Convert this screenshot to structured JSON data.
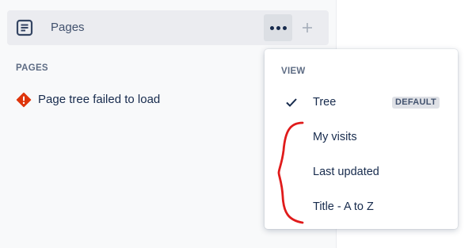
{
  "sidebar": {
    "pages_row": {
      "label": "Pages",
      "icon": "document-icon",
      "more_icon": "more-icon",
      "add_icon": "plus-icon"
    },
    "section_heading": "PAGES",
    "error": {
      "icon": "warning-icon",
      "text": "Page tree failed to load",
      "color": "#de350b"
    }
  },
  "menu": {
    "heading": "VIEW",
    "items": [
      {
        "label": "Tree",
        "checked": true,
        "badge": "DEFAULT"
      },
      {
        "label": "My visits",
        "checked": false
      },
      {
        "label": "Last updated",
        "checked": false
      },
      {
        "label": "Title - A to Z",
        "checked": false
      }
    ]
  },
  "annotation": {
    "shape": "red-curly-bracket",
    "color": "#e01b1b"
  }
}
